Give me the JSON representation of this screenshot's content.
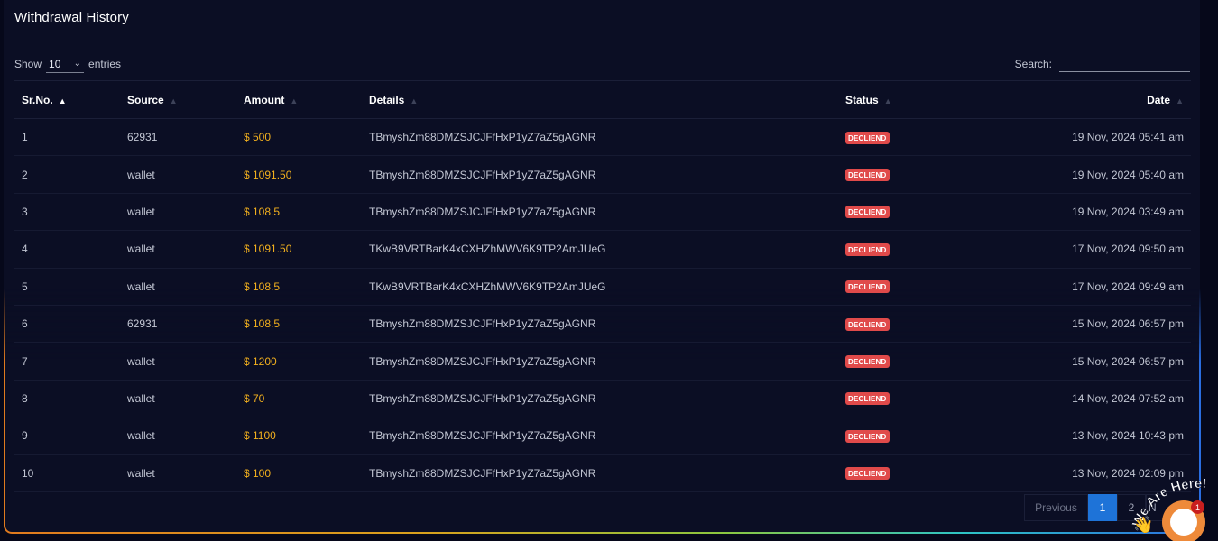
{
  "page": {
    "title": "Withdrawal History"
  },
  "length_menu": {
    "prefix": "Show",
    "value": "10",
    "suffix": "entries"
  },
  "search": {
    "label": "Search:",
    "value": ""
  },
  "table": {
    "columns": [
      "Sr.No.",
      "Source",
      "Amount",
      "Details",
      "Status",
      "Date"
    ],
    "rows": [
      {
        "sr": "1",
        "source": "62931",
        "amount": "$ 500",
        "details": "TBmyshZm88DMZSJCJFfHxP1yZ7aZ5gAGNR",
        "status": "DECLIEND",
        "date": "19 Nov, 2024 05:41 am"
      },
      {
        "sr": "2",
        "source": "wallet",
        "amount": "$ 1091.50",
        "details": "TBmyshZm88DMZSJCJFfHxP1yZ7aZ5gAGNR",
        "status": "DECLIEND",
        "date": "19 Nov, 2024 05:40 am"
      },
      {
        "sr": "3",
        "source": "wallet",
        "amount": "$ 108.5",
        "details": "TBmyshZm88DMZSJCJFfHxP1yZ7aZ5gAGNR",
        "status": "DECLIEND",
        "date": "19 Nov, 2024 03:49 am"
      },
      {
        "sr": "4",
        "source": "wallet",
        "amount": "$ 1091.50",
        "details": "TKwB9VRTBarK4xCXHZhMWV6K9TP2AmJUeG",
        "status": "DECLIEND",
        "date": "17 Nov, 2024 09:50 am"
      },
      {
        "sr": "5",
        "source": "wallet",
        "amount": "$ 108.5",
        "details": "TKwB9VRTBarK4xCXHZhMWV6K9TP2AmJUeG",
        "status": "DECLIEND",
        "date": "17 Nov, 2024 09:49 am"
      },
      {
        "sr": "6",
        "source": "62931",
        "amount": "$ 108.5",
        "details": "TBmyshZm88DMZSJCJFfHxP1yZ7aZ5gAGNR",
        "status": "DECLIEND",
        "date": "15 Nov, 2024 06:57 pm"
      },
      {
        "sr": "7",
        "source": "wallet",
        "amount": "$ 1200",
        "details": "TBmyshZm88DMZSJCJFfHxP1yZ7aZ5gAGNR",
        "status": "DECLIEND",
        "date": "15 Nov, 2024 06:57 pm"
      },
      {
        "sr": "8",
        "source": "wallet",
        "amount": "$ 70",
        "details": "TBmyshZm88DMZSJCJFfHxP1yZ7aZ5gAGNR",
        "status": "DECLIEND",
        "date": "14 Nov, 2024 07:52 am"
      },
      {
        "sr": "9",
        "source": "wallet",
        "amount": "$ 1100",
        "details": "TBmyshZm88DMZSJCJFfHxP1yZ7aZ5gAGNR",
        "status": "DECLIEND",
        "date": "13 Nov, 2024 10:43 pm"
      },
      {
        "sr": "10",
        "source": "wallet",
        "amount": "$ 100",
        "details": "TBmyshZm88DMZSJCJFfHxP1yZ7aZ5gAGNR",
        "status": "DECLIEND",
        "date": "13 Nov, 2024 02:09 pm"
      }
    ]
  },
  "pagination": {
    "previous": "Previous",
    "pages": [
      "1",
      "2"
    ],
    "active": "1",
    "partial_next": "N"
  },
  "chat_widget": {
    "tagline": "We Are Here!",
    "unread": "1",
    "icon": "chat-bubble-icon",
    "wave_icon": "waving-hand-icon"
  },
  "colors": {
    "amount": "#f2b01e",
    "badge": "#e04a4a",
    "active_page": "#1e73d8",
    "chat": "#ee8a3a"
  }
}
